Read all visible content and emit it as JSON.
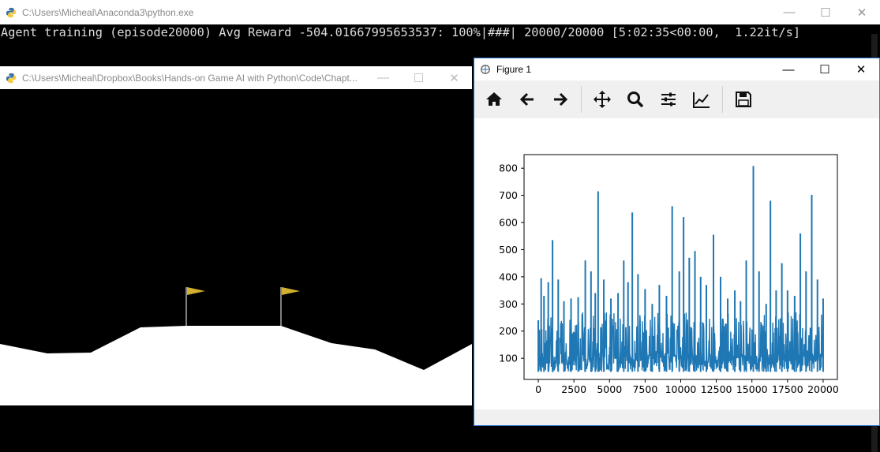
{
  "console": {
    "title": "C:\\Users\\Micheal\\Anaconda3\\python.exe",
    "progress_line": "Agent training (episode20000) Avg Reward -504.01667995653537: 100%|###| 20000/20000 [5:02:35<00:00,  1.22it/s]",
    "controls": {
      "minimize": "—",
      "maximize": "☐",
      "close": "✕"
    }
  },
  "game_window": {
    "title": "C:\\Users\\Micheal\\Dropbox\\Books\\Hands-on Game AI with Python\\Code\\Chapt...",
    "controls": {
      "minimize": "—",
      "maximize": "☐",
      "close": "✕"
    },
    "colors": {
      "sky": "#000000",
      "ground": "#ffffff",
      "flag": "#d4b030",
      "pole": "#ffffff"
    }
  },
  "figure": {
    "title": "Figure 1",
    "controls": {
      "minimize": "—",
      "maximize": "☐",
      "close": "✕"
    },
    "toolbar": [
      "home-icon",
      "back-icon",
      "forward-icon",
      "pan-icon",
      "zoom-icon",
      "configure-subplots-icon",
      "edit-axis-icon",
      "save-icon"
    ]
  },
  "chart_data": {
    "type": "line",
    "color": "#1f77b4",
    "xlim": [
      -1000,
      21000
    ],
    "ylim": [
      22,
      850
    ],
    "x_ticks": [
      0,
      2500,
      5000,
      7500,
      10000,
      12500,
      15000,
      17500,
      20000
    ],
    "x_tick_labels": [
      "0",
      "2500",
      "5000",
      "7500",
      "10000",
      "12500",
      "15000",
      "17500",
      "20000"
    ],
    "y_ticks": [
      100,
      200,
      300,
      400,
      500,
      600,
      700,
      800
    ],
    "y_tick_labels": [
      "100",
      "200",
      "300",
      "400",
      "500",
      "600",
      "700",
      "800"
    ],
    "series": [
      {
        "baseline_range": [
          50,
          120
        ],
        "points_x": [
          0,
          200,
          400,
          700,
          1000,
          1400,
          1800,
          2300,
          2800,
          3300,
          3700,
          4000,
          4200,
          4600,
          5100,
          5600,
          6000,
          6300,
          6600,
          7000,
          7500,
          8000,
          8500,
          9000,
          9400,
          9900,
          10200,
          10600,
          11000,
          11400,
          11800,
          12300,
          12800,
          13300,
          13800,
          14200,
          14600,
          15100,
          15500,
          16000,
          16300,
          16700,
          17100,
          17500,
          18000,
          18400,
          18800,
          19200,
          19600,
          20000
        ],
        "points_y": [
          240,
          395,
          330,
          380,
          535,
          390,
          310,
          320,
          325,
          460,
          420,
          340,
          715,
          390,
          320,
          340,
          460,
          380,
          637,
          410,
          355,
          300,
          370,
          330,
          660,
          420,
          620,
          470,
          495,
          400,
          370,
          555,
          400,
          320,
          350,
          310,
          460,
          808,
          420,
          300,
          680,
          350,
          450,
          350,
          330,
          560,
          420,
          702,
          390,
          320
        ]
      }
    ]
  }
}
